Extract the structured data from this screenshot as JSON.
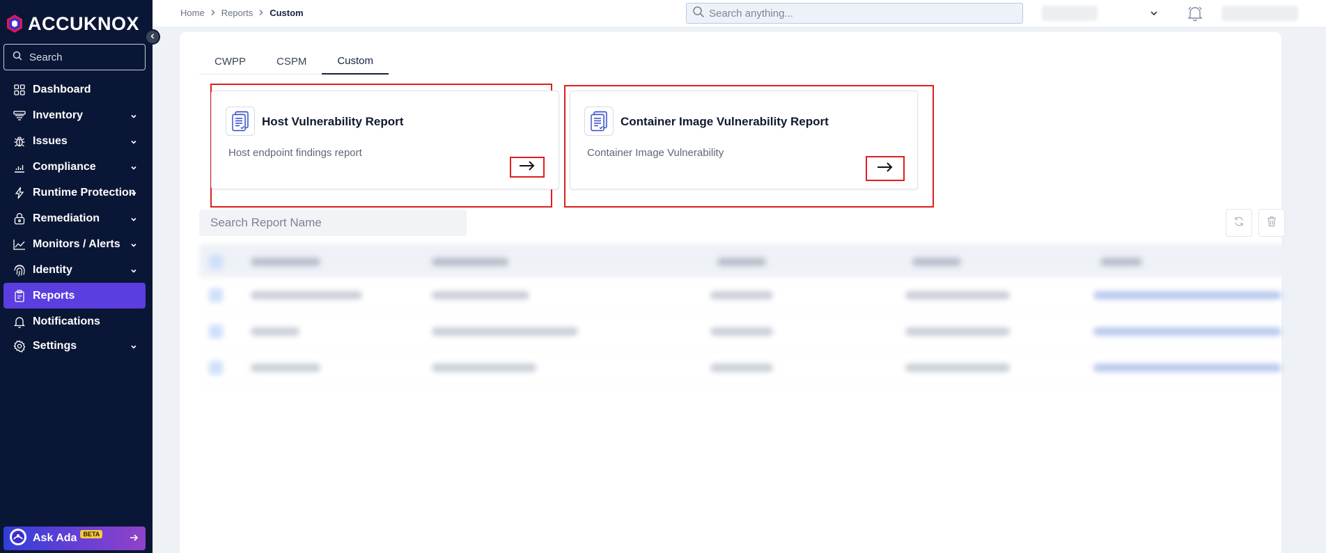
{
  "app": {
    "logo_text": "ACCUKNOX",
    "brand_color": "#5b3de0",
    "sidebar_bg": "#0a1635"
  },
  "sidebar": {
    "search_placeholder": "Search",
    "items": [
      {
        "label": "Dashboard",
        "icon": "grid-icon",
        "has_chevron": false,
        "active": false
      },
      {
        "label": "Inventory",
        "icon": "stack-icon",
        "has_chevron": true,
        "active": false
      },
      {
        "label": "Issues",
        "icon": "bug-icon",
        "has_chevron": true,
        "active": false
      },
      {
        "label": "Compliance",
        "icon": "bar-chart-icon",
        "has_chevron": true,
        "active": false
      },
      {
        "label": "Runtime Protection",
        "icon": "bolt-icon",
        "has_chevron": true,
        "active": false
      },
      {
        "label": "Remediation",
        "icon": "lock-icon",
        "has_chevron": true,
        "active": false
      },
      {
        "label": "Monitors / Alerts",
        "icon": "line-chart-icon",
        "has_chevron": true,
        "active": false
      },
      {
        "label": "Identity",
        "icon": "fingerprint-icon",
        "has_chevron": true,
        "active": false
      },
      {
        "label": "Reports",
        "icon": "clipboard-icon",
        "has_chevron": false,
        "active": true
      },
      {
        "label": "Notifications",
        "icon": "bell-icon",
        "has_chevron": false,
        "active": false
      },
      {
        "label": "Settings",
        "icon": "gear-icon",
        "has_chevron": true,
        "active": false
      }
    ],
    "ask_ada": {
      "label": "Ask Ada",
      "badge": "BETA"
    }
  },
  "topbar": {
    "breadcrumb": [
      "Home",
      "Reports",
      "Custom"
    ],
    "search_placeholder": "Search anything..."
  },
  "tabs": [
    {
      "label": "CWPP",
      "active": false
    },
    {
      "label": "CSPM",
      "active": false
    },
    {
      "label": "Custom",
      "active": true
    }
  ],
  "report_cards": [
    {
      "title": "Host Vulnerability Report",
      "subtitle": "Host endpoint findings report",
      "icon": "document-icon"
    },
    {
      "title": "Container Image Vulnerability Report",
      "subtitle": "Container Image Vulnerability",
      "icon": "document-icon"
    }
  ],
  "report_search": {
    "placeholder": "Search Report Name"
  },
  "annotation_color": "#e01d1d"
}
